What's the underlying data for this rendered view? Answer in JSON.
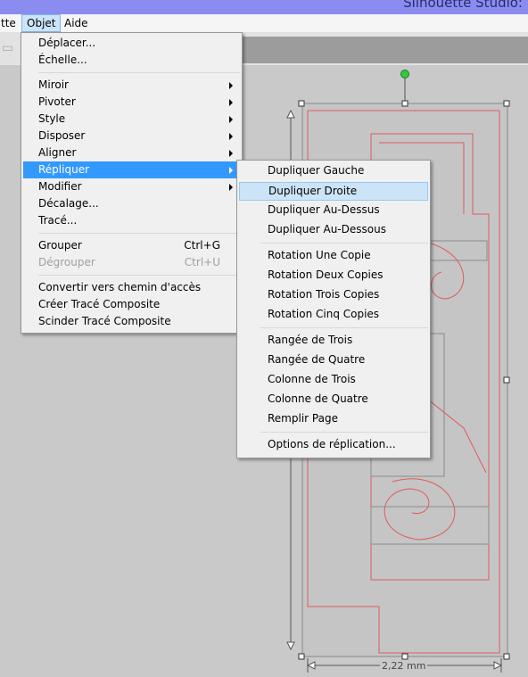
{
  "app": {
    "title": "Silhouette Studio:"
  },
  "menubar": [
    {
      "label": "tte",
      "state": "normal"
    },
    {
      "label": "Objet",
      "state": "open"
    },
    {
      "label": "Aide",
      "state": "normal"
    }
  ],
  "objet_menu": [
    {
      "label": "Déplacer...",
      "state": "normal"
    },
    {
      "label": "Échelle...",
      "state": "normal"
    },
    {
      "label": "Miroir",
      "submenu": true
    },
    {
      "label": "Pivoter",
      "submenu": true
    },
    {
      "label": "Style",
      "submenu": true
    },
    {
      "label": "Disposer",
      "submenu": true
    },
    {
      "label": "Aligner",
      "submenu": true
    },
    {
      "label": "Répliquer",
      "submenu": true,
      "state": "highlighted"
    },
    {
      "label": "Modifier",
      "submenu": true
    },
    {
      "label": "Décalage...",
      "state": "normal"
    },
    {
      "label": "Tracé...",
      "state": "normal"
    },
    {
      "label": "Grouper",
      "shortcut": "Ctrl+G"
    },
    {
      "label": "Dégrouper",
      "shortcut": "Ctrl+U",
      "state": "disabled"
    },
    {
      "label": "Convertir vers chemin d'accès"
    },
    {
      "label": "Créer Tracé Composite"
    },
    {
      "label": "Scinder Tracé Composite"
    }
  ],
  "repliquer_submenu": [
    {
      "label": "Dupliquer Gauche"
    },
    {
      "label": "Dupliquer Droite",
      "state": "hover"
    },
    {
      "label": "Dupliquer Au-Dessus"
    },
    {
      "label": "Dupliquer Au-Dessous"
    },
    {
      "label": "Rotation Une Copie"
    },
    {
      "label": "Rotation Deux Copies"
    },
    {
      "label": "Rotation Trois Copies"
    },
    {
      "label": "Rotation Cinq Copies"
    },
    {
      "label": "Rangée de Trois"
    },
    {
      "label": "Rangée de Quatre"
    },
    {
      "label": "Colonne de Trois"
    },
    {
      "label": "Colonne de Quatre"
    },
    {
      "label": "Remplir Page"
    },
    {
      "label": "Options de réplication..."
    }
  ],
  "canvas": {
    "width_dimension": "2,22 mm",
    "shape_color": "#e05a5a",
    "selection_handle_color": "#2ecc40"
  },
  "colors": {
    "menu_highlight": "#3399ff",
    "menu_hover": "#cce4f7",
    "titlebar": "#8b8cf0"
  }
}
